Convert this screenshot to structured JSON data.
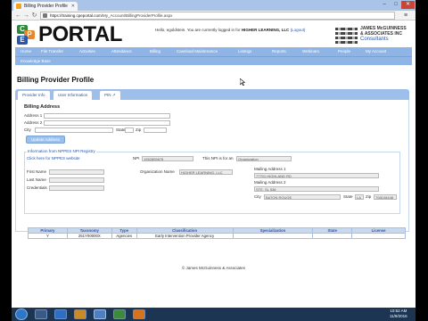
{
  "browser": {
    "tab_title": "Billing Provider Profile",
    "address_host": "https://training.cpeportal.com",
    "address_path": "/My_Account/BillingProviderProfile.aspx"
  },
  "header": {
    "logo_letters": [
      "C",
      "P",
      "E"
    ],
    "portal_text": "PORTAL",
    "hello_text": "Hello, egoldstein. You are currently logged in for ",
    "org_name": "HIGHER LEARNING, LLC",
    "logout_text": " (Logout)",
    "jm_line1": "JAMES McGUINNESS",
    "jm_line2": "& ASSOCIATES INC",
    "jm_line3": "Consultants"
  },
  "nav": {
    "row1": [
      "Home",
      "File Transfer",
      "Activities",
      "Attendance",
      "Billing",
      "Caseload Maintenance",
      "Listings",
      "Reports",
      "Webinars",
      "People",
      "My Account"
    ],
    "row2": [
      "Knowledge Base"
    ]
  },
  "page_title": "Billing Provider Profile",
  "tabs": [
    "Provider Info",
    "User Information",
    "PIN ↗"
  ],
  "billing_address": {
    "title": "Billing Address",
    "address1_label": "Address 1",
    "address2_label": "Address 2",
    "city_label": "City",
    "state_label": "State",
    "zip_label": "Zip",
    "update_button": "Update Address"
  },
  "nppes": {
    "legend": "Information from NPPES NPI Registry",
    "link": "Click here for NPPES website",
    "npi_label": "NPI",
    "npi_value": "1952805678",
    "npi_for_label": "This NPI is for an",
    "npi_for_value": "Organization",
    "first_name_label": "First Name",
    "last_name_label": "Last Name",
    "credentials_label": "Credentials",
    "org_name_label": "Organization Name",
    "org_name_value": "HIGHER LEARNING, LLC",
    "mailing1_label": "Mailing Address 1",
    "mailing1_value": "77701 HIGHLAND RD",
    "mailing2_label": "Mailing Address 2",
    "mailing2_value": "STE. SL 536",
    "city_label": "City",
    "city_value": "BATON ROUGE",
    "state_label": "State",
    "state_value": "LA",
    "zip_label": "Zip",
    "zip_value": "708108448"
  },
  "taxonomy_table": {
    "headers": [
      "Primary",
      "Taxonomy",
      "Type",
      "Classification",
      "Specialization",
      "State",
      "License"
    ],
    "rows": [
      [
        "Y",
        "251Y00000X",
        "Agencies",
        "Early Intervention Provider Agency",
        "",
        "",
        ""
      ]
    ]
  },
  "footer": "© James McGuinness & Associates",
  "taskbar": {
    "time": "10:52 AM",
    "date": "11/9/2016"
  }
}
